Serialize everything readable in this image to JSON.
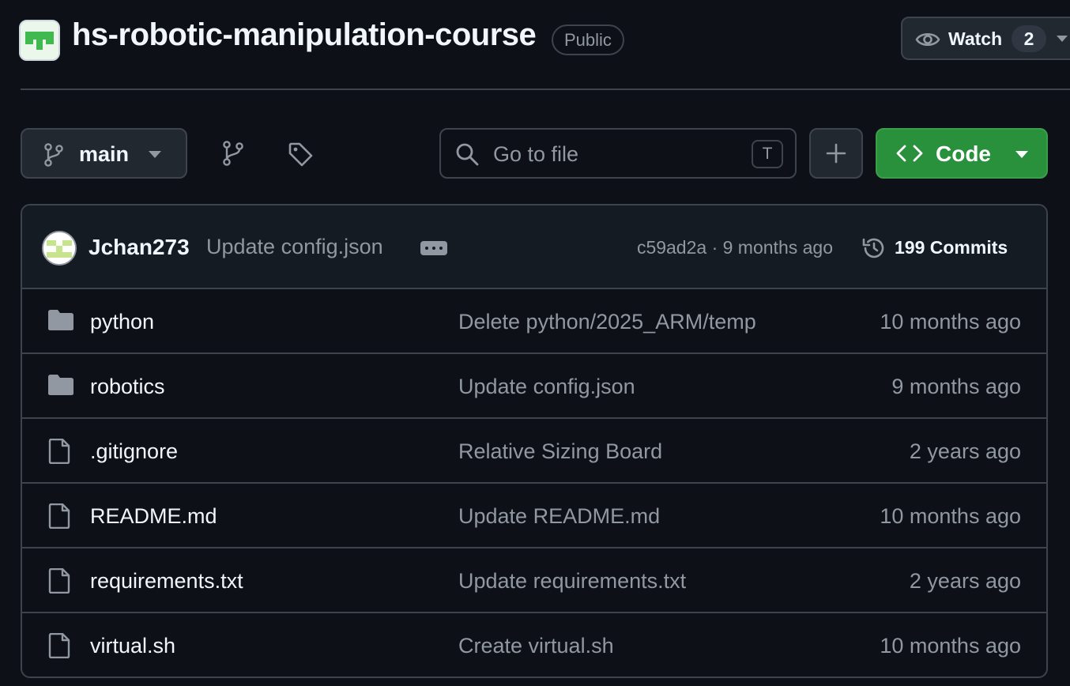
{
  "repo": {
    "name": "hs-robotic-manipulation-course",
    "visibility": "Public",
    "avatar_color": "#3fb950"
  },
  "watch": {
    "label": "Watch",
    "count": "2"
  },
  "toolbar": {
    "branch": "main",
    "search_placeholder": "Go to file",
    "search_shortcut": "T",
    "code_label": "Code",
    "code_color": "#29903b"
  },
  "latest_commit": {
    "author": "Jchan273",
    "message": "Update config.json",
    "meta": "c59ad2a · 9 months ago",
    "commits_label": "199 Commits"
  },
  "files": [
    {
      "type": "folder",
      "name": "python",
      "message": "Delete python/2025_ARM/temp",
      "date": "10 months ago"
    },
    {
      "type": "folder",
      "name": "robotics",
      "message": "Update config.json",
      "date": "9 months ago"
    },
    {
      "type": "file",
      "name": ".gitignore",
      "message": "Relative Sizing Board",
      "date": "2 years ago"
    },
    {
      "type": "file",
      "name": "README.md",
      "message": "Update README.md",
      "date": "10 months ago"
    },
    {
      "type": "file",
      "name": "requirements.txt",
      "message": "Update requirements.txt",
      "date": "2 years ago"
    },
    {
      "type": "file",
      "name": "virtual.sh",
      "message": "Create virtual.sh",
      "date": "10 months ago"
    }
  ]
}
